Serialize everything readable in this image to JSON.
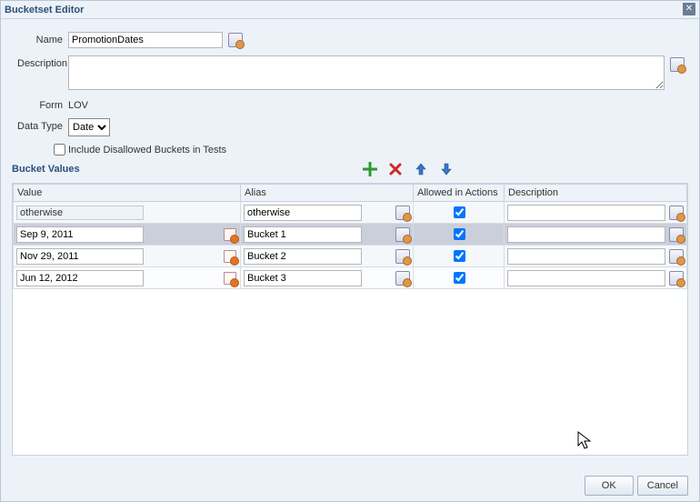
{
  "dialog": {
    "title": "Bucketset Editor"
  },
  "form": {
    "name_label": "Name",
    "name_value": "PromotionDates",
    "description_label": "Description",
    "description_value": "",
    "form_label": "Form",
    "form_value": "LOV",
    "datatype_label": "Data Type",
    "datatype_value": "Date",
    "include_disallowed_label": "Include Disallowed Buckets in Tests"
  },
  "section": {
    "bucket_values": "Bucket Values"
  },
  "table": {
    "headers": {
      "value": "Value",
      "alias": "Alias",
      "allowed": "Allowed in Actions",
      "description": "Description"
    },
    "rows": [
      {
        "value": "otherwise",
        "alias": "otherwise",
        "allowed": true,
        "has_date_picker": false,
        "desc": "",
        "value_readonly": true
      },
      {
        "value": "Sep 9, 2011",
        "alias": "Bucket 1",
        "allowed": true,
        "has_date_picker": true,
        "desc": "",
        "selected": true
      },
      {
        "value": "Nov 29, 2011",
        "alias": "Bucket 2",
        "allowed": true,
        "has_date_picker": true,
        "desc": ""
      },
      {
        "value": "Jun 12, 2012",
        "alias": "Bucket 3",
        "allowed": true,
        "has_date_picker": true,
        "desc": ""
      }
    ]
  },
  "buttons": {
    "ok": "OK",
    "cancel": "Cancel"
  },
  "icons": {
    "add": "add-icon",
    "delete": "delete-icon",
    "up": "up-icon",
    "down": "down-icon",
    "close": "close-icon",
    "validation": "validation-icon",
    "calendar": "calendar-icon"
  }
}
